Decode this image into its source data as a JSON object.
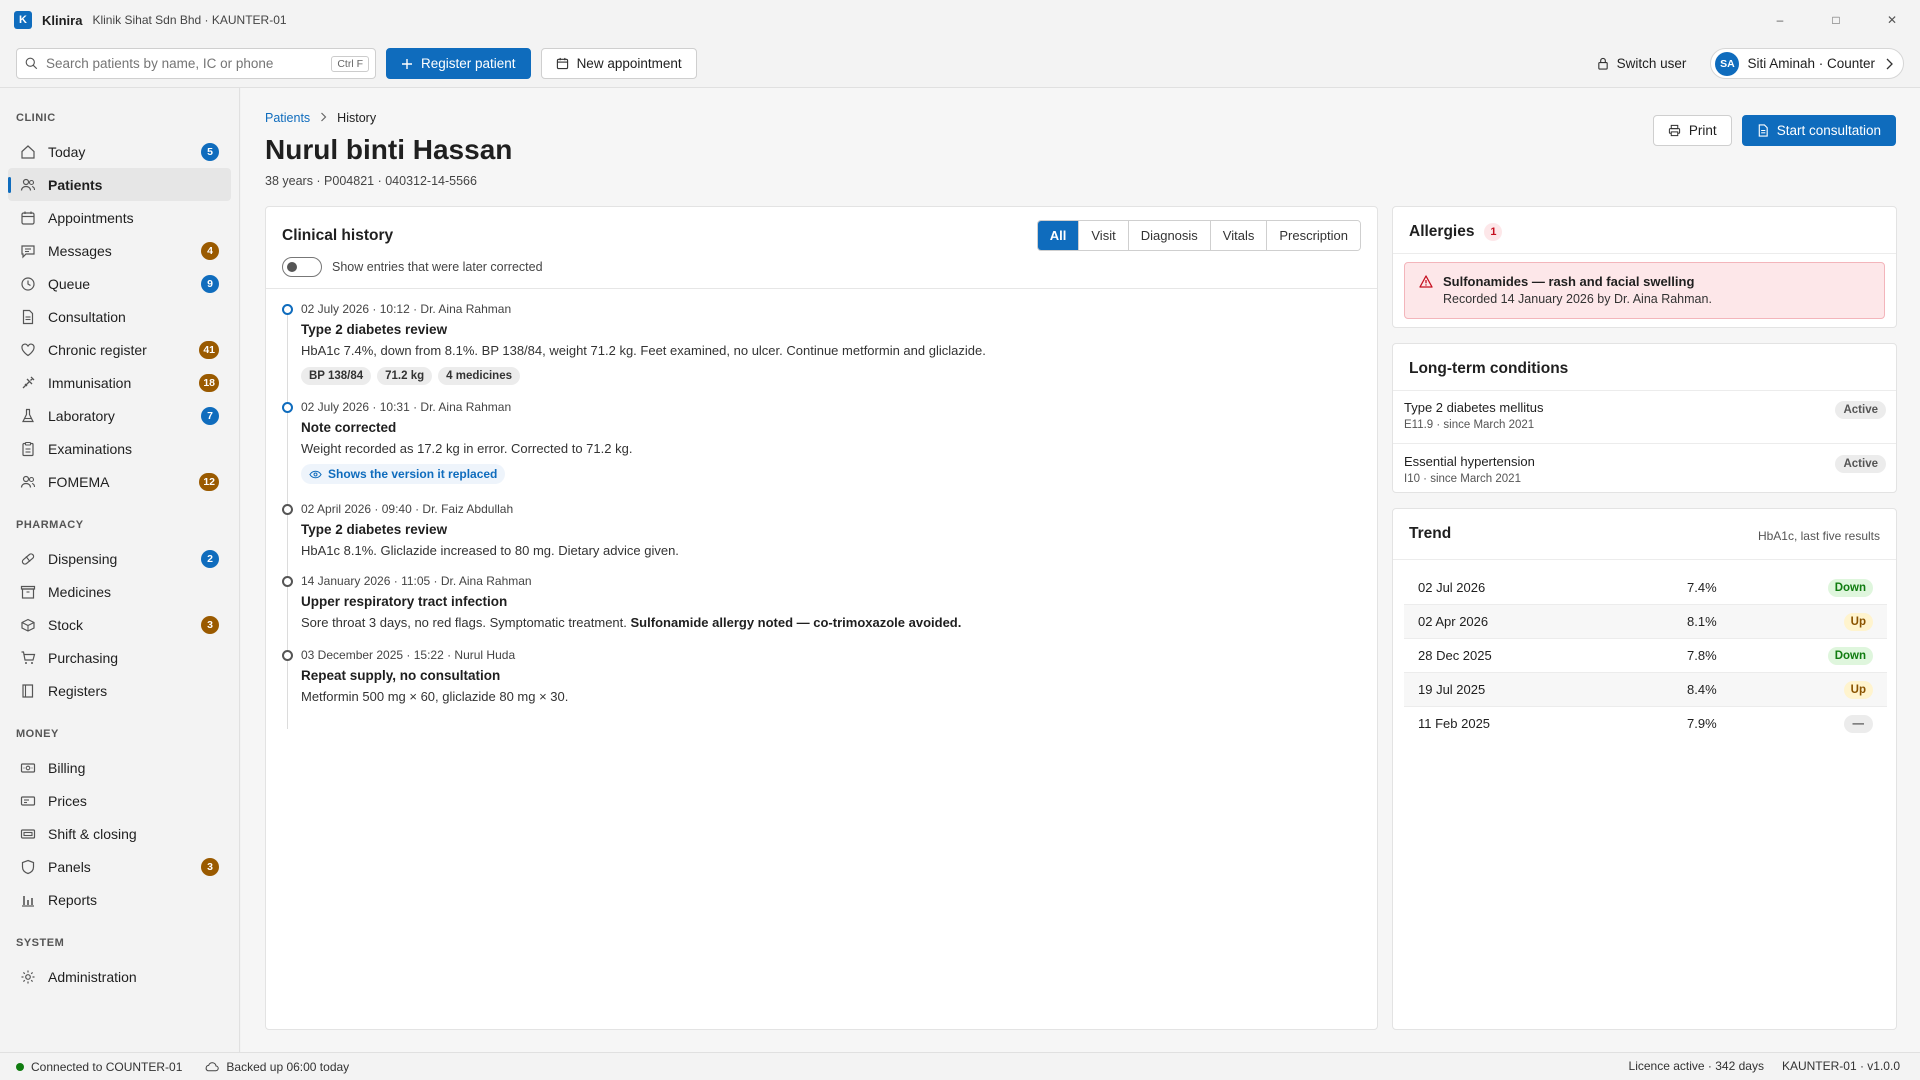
{
  "app": {
    "logo": "K",
    "name": "Klinira",
    "subtitle": "Klinik Sihat Sdn Bhd · KAUNTER-01"
  },
  "window_controls": {
    "minimize": "–",
    "maximize": "□",
    "close": "✕"
  },
  "toolbar": {
    "search_placeholder": "Search patients by name, IC or phone",
    "search_shortcut": "Ctrl F",
    "register_label": "Register patient",
    "appointment_label": "New appointment",
    "switch_user_label": "Switch user",
    "user_initials": "SA",
    "user_label": "Siti Aminah · Counter"
  },
  "sidebar": {
    "sections": [
      {
        "title": "CLINIC",
        "items": [
          {
            "label": "Today",
            "icon": "home-icon",
            "badge": "5",
            "badge_color": "#0f6cbd"
          },
          {
            "label": "Patients",
            "icon": "people-icon",
            "badge": "",
            "badge_color": "",
            "active": true
          },
          {
            "label": "Appointments",
            "icon": "calendar-icon",
            "badge": "",
            "badge_color": ""
          },
          {
            "label": "Messages",
            "icon": "chat-icon",
            "badge": "4",
            "badge_color": "#9a5a00"
          },
          {
            "label": "Queue",
            "icon": "clock-icon",
            "badge": "9",
            "badge_color": "#0f6cbd"
          },
          {
            "label": "Consultation",
            "icon": "document-icon",
            "badge": "",
            "badge_color": ""
          },
          {
            "label": "Chronic register",
            "icon": "heart-icon",
            "badge": "41",
            "badge_color": "#9a5a00"
          },
          {
            "label": "Immunisation",
            "icon": "syringe-icon",
            "badge": "18",
            "badge_color": "#9a5a00"
          },
          {
            "label": "Laboratory",
            "icon": "flask-icon",
            "badge": "7",
            "badge_color": "#0f6cbd"
          },
          {
            "label": "Examinations",
            "icon": "clipboard-icon",
            "badge": "",
            "badge_color": ""
          },
          {
            "label": "FOMEMA",
            "icon": "people-icon",
            "badge": "12",
            "badge_color": "#9a5a00"
          }
        ]
      },
      {
        "title": "PHARMACY",
        "items": [
          {
            "label": "Dispensing",
            "icon": "pill-icon",
            "badge": "2",
            "badge_color": "#0f6cbd"
          },
          {
            "label": "Medicines",
            "icon": "box-icon",
            "badge": "",
            "badge_color": ""
          },
          {
            "label": "Stock",
            "icon": "stock-icon",
            "badge": "3",
            "badge_color": "#9a5a00"
          },
          {
            "label": "Purchasing",
            "icon": "cart-icon",
            "badge": "",
            "badge_color": ""
          },
          {
            "label": "Registers",
            "icon": "book-icon",
            "badge": "",
            "badge_color": ""
          }
        ]
      },
      {
        "title": "MONEY",
        "items": [
          {
            "label": "Billing",
            "icon": "money-icon",
            "badge": "",
            "badge_color": ""
          },
          {
            "label": "Prices",
            "icon": "tag-icon",
            "badge": "",
            "badge_color": ""
          },
          {
            "label": "Shift & closing",
            "icon": "register-icon",
            "badge": "",
            "badge_color": ""
          },
          {
            "label": "Panels",
            "icon": "shield-icon",
            "badge": "3",
            "badge_color": "#9a5a00"
          },
          {
            "label": "Reports",
            "icon": "bar-chart-icon",
            "badge": "",
            "badge_color": ""
          }
        ]
      },
      {
        "title": "SYSTEM",
        "items": [
          {
            "label": "Administration",
            "icon": "gear-icon",
            "badge": "",
            "badge_color": ""
          }
        ]
      }
    ]
  },
  "breadcrumb": {
    "root": "Patients",
    "separator": ">",
    "current": "History"
  },
  "patient": {
    "name": "Nurul binti Hassan",
    "meta": "38 years · P004821 · 040312-14-5566"
  },
  "header_actions": {
    "print_label": "Print",
    "start_label": "Start consultation"
  },
  "history": {
    "title": "Clinical history",
    "toggle_label": "Show entries that were later corrected",
    "filters": [
      "All",
      "Visit",
      "Diagnosis",
      "Vitals",
      "Prescription"
    ],
    "active_filter": "All",
    "entries": [
      {
        "meta": "02 July 2026 · 10:12 · Dr. Aina Rahman",
        "title": "Type 2 diabetes review",
        "body": "HbA1c 7.4%, down from 8.1%. BP 138/84, weight 71.2 kg. Feet examined, no ulcer. Continue metformin and gliclazide.",
        "chips": [
          "BP 138/84",
          "71.2 kg",
          "4 medicines"
        ],
        "dot": "blue"
      },
      {
        "meta": "02 July 2026 · 10:31 · Dr. Aina Rahman",
        "title": "Note corrected",
        "body": "Weight recorded as 17.2 kg in error. Corrected to 71.2 kg.",
        "link": "Shows the version it replaced",
        "dot": "blue"
      },
      {
        "meta": "02 April 2026 · 09:40 · Dr. Faiz Abdullah",
        "title": "Type 2 diabetes review",
        "body": "HbA1c 8.1%. Gliclazide increased to 80 mg. Dietary advice given.",
        "dot": "grey"
      },
      {
        "meta": "14 January 2026 · 11:05 · Dr. Aina Rahman",
        "title": "Upper respiratory tract infection",
        "body": "Sore throat 3 days, no red flags. Symptomatic treatment.",
        "body_strong": "Sulfonamide allergy noted — co-trimoxazole avoided.",
        "dot": "grey"
      },
      {
        "meta": "03 December 2025 · 15:22 · Nurul Huda",
        "title": "Repeat supply, no consultation",
        "body": "Metformin 500 mg × 60, gliclazide 80 mg × 30.",
        "dot": "grey"
      }
    ]
  },
  "allergies": {
    "title": "Allergies",
    "count": "1",
    "alert_title": "Sulfonamides — rash and facial swelling",
    "alert_sub": "Recorded 14 January 2026 by Dr. Aina Rahman."
  },
  "conditions": {
    "title": "Long-term conditions",
    "items": [
      {
        "name": "Type 2 diabetes mellitus",
        "code": "E11.9 · since March 2021",
        "status": "Active"
      },
      {
        "name": "Essential hypertension",
        "code": "I10 · since March 2021",
        "status": "Active"
      }
    ]
  },
  "trend": {
    "title": "Trend",
    "subtitle": "HbA1c, last five results",
    "rows": [
      {
        "date": "02 Jul 2026",
        "value": "7.4%",
        "direction": "Down",
        "kind": "down"
      },
      {
        "date": "02 Apr 2026",
        "value": "8.1%",
        "direction": "Up",
        "kind": "up"
      },
      {
        "date": "28 Dec 2025",
        "value": "7.8%",
        "direction": "Down",
        "kind": "down"
      },
      {
        "date": "19 Jul 2025",
        "value": "8.4%",
        "direction": "Up",
        "kind": "up"
      },
      {
        "date": "11 Feb 2025",
        "value": "7.9%",
        "direction": "—",
        "kind": "flat"
      }
    ]
  },
  "statusbar": {
    "connection": "Connected to COUNTER-01",
    "backup": "Backed up 06:00 today",
    "licence": "Licence active · 342 days",
    "version": "KAUNTER-01 · v1.0.0"
  },
  "colors": {
    "accent": "#0f6cbd",
    "warning_badge": "#9a5a00",
    "alert_bg": "#fde7e9",
    "alert_icon": "#c50f1f",
    "online": "#107c10"
  }
}
